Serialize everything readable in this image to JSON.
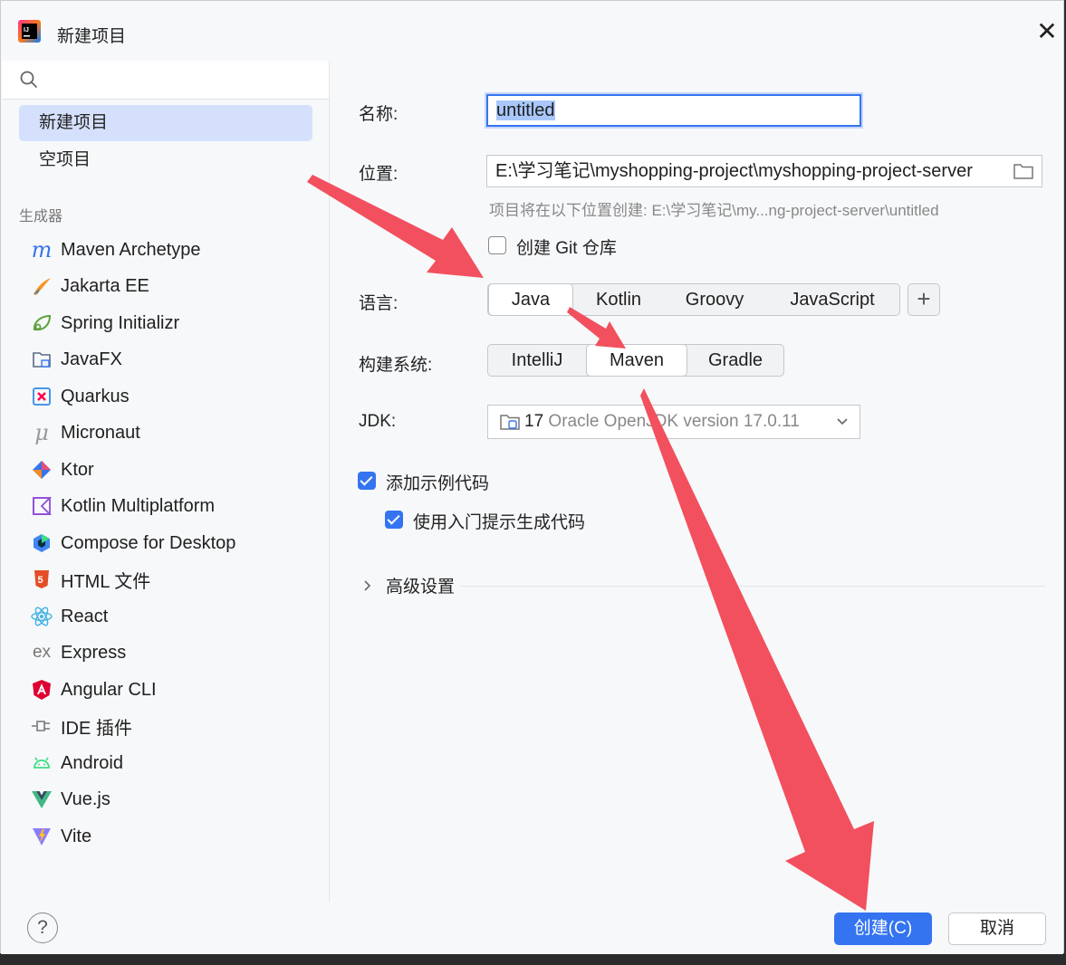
{
  "window": {
    "title": "新建项目"
  },
  "search": {
    "placeholder": ""
  },
  "sidebar": {
    "top_items": [
      {
        "label": "新建项目",
        "selected": true
      },
      {
        "label": "空项目",
        "selected": false
      }
    ],
    "group_label": "生成器",
    "generators": [
      {
        "label": "Maven Archetype",
        "icon": "maven-icon"
      },
      {
        "label": "Jakarta EE",
        "icon": "jakarta-icon"
      },
      {
        "label": "Spring Initializr",
        "icon": "spring-icon"
      },
      {
        "label": "JavaFX",
        "icon": "javafx-icon"
      },
      {
        "label": "Quarkus",
        "icon": "quarkus-icon"
      },
      {
        "label": "Micronaut",
        "icon": "micronaut-icon"
      },
      {
        "label": "Ktor",
        "icon": "ktor-icon"
      },
      {
        "label": "Kotlin Multiplatform",
        "icon": "kotlin-icon"
      },
      {
        "label": "Compose for Desktop",
        "icon": "compose-icon"
      },
      {
        "label": "HTML 文件",
        "icon": "html5-icon"
      },
      {
        "label": "React",
        "icon": "react-icon"
      },
      {
        "label": "Express",
        "icon": "express-icon"
      },
      {
        "label": "Angular CLI",
        "icon": "angular-icon"
      },
      {
        "label": "IDE 插件",
        "icon": "plugin-icon"
      },
      {
        "label": "Android",
        "icon": "android-icon"
      },
      {
        "label": "Vue.js",
        "icon": "vue-icon"
      },
      {
        "label": "Vite",
        "icon": "vite-icon"
      }
    ]
  },
  "form": {
    "name_label": "名称:",
    "name_value": "untitled",
    "location_label": "位置:",
    "location_value": "E:\\学习笔记\\myshopping-project\\myshopping-project-server",
    "location_hint": "项目将在以下位置创建: E:\\学习笔记\\my...ng-project-server\\untitled",
    "git_label": "创建 Git 仓库",
    "git_checked": false,
    "language_label": "语言:",
    "languages": [
      "Java",
      "Kotlin",
      "Groovy",
      "JavaScript"
    ],
    "language_selected": "Java",
    "build_label": "构建系统:",
    "build_systems": [
      "IntelliJ",
      "Maven",
      "Gradle"
    ],
    "build_selected": "Maven",
    "jdk_label": "JDK:",
    "jdk_version": "17",
    "jdk_name": "Oracle OpenJDK version 17.0.11",
    "sample_code_label": "添加示例代码",
    "sample_code_checked": true,
    "onboarding_label": "使用入门提示生成代码",
    "onboarding_checked": true,
    "advanced_label": "高级设置"
  },
  "footer": {
    "help": "?",
    "create_label": "创建(C)",
    "cancel_label": "取消"
  },
  "colors": {
    "accent": "#3574f0",
    "arrow": "#f2505e",
    "selection": "#d5e1fc"
  }
}
